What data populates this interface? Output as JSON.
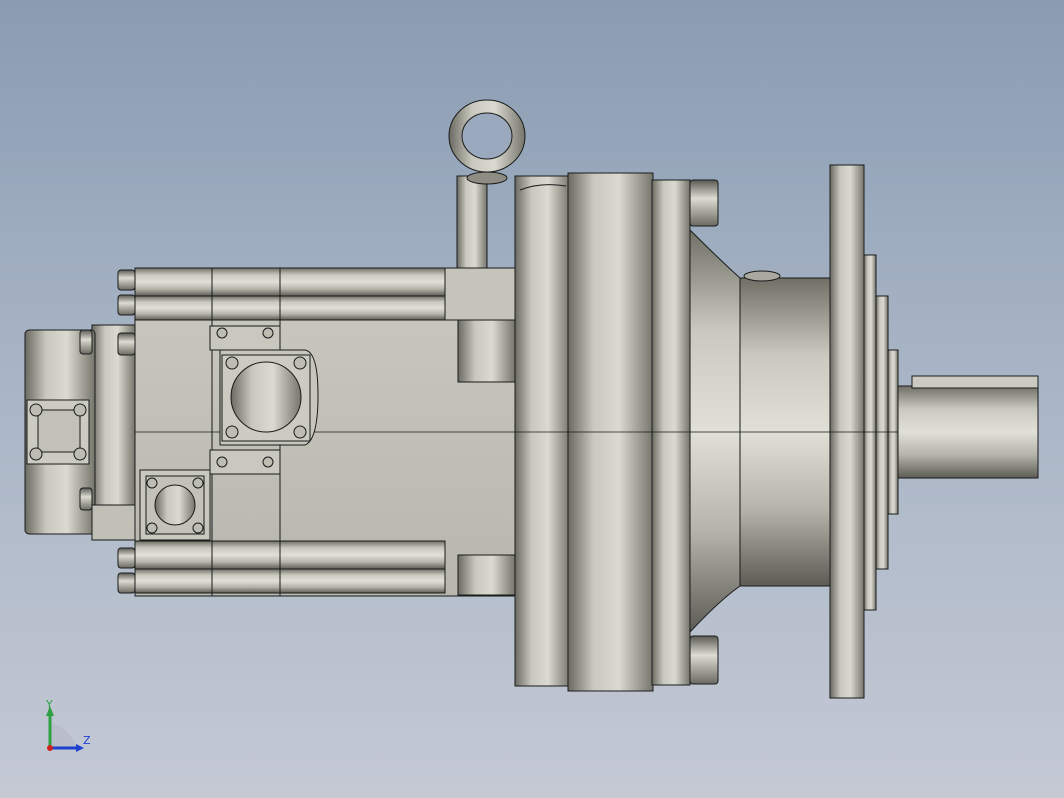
{
  "viewport": {
    "background_top": "#8a9cb2",
    "background_bottom": "#c4c9d4",
    "model_color": "#bdbdb2",
    "edge_color": "#1a1a1a"
  },
  "triad": {
    "y_label": "Y",
    "z_label": "Z",
    "y_color": "#2ea043",
    "z_color": "#2040d0",
    "x_color": "#d02020"
  }
}
